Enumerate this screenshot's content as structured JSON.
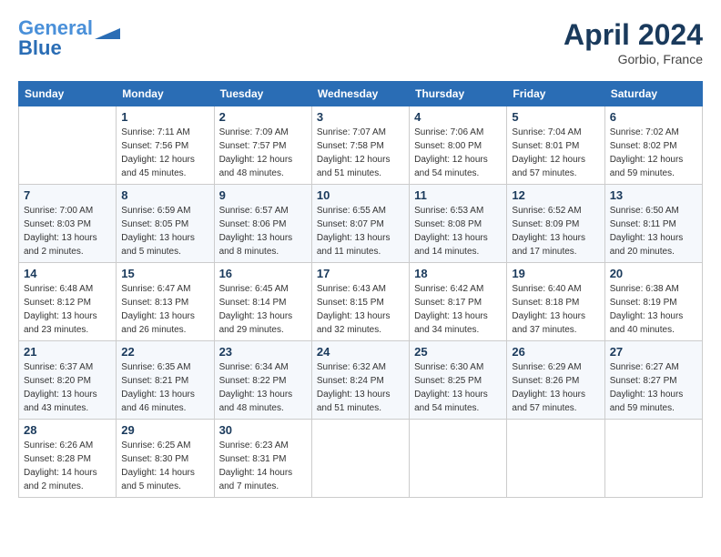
{
  "header": {
    "logo_line1": "General",
    "logo_line2": "Blue",
    "month_title": "April 2024",
    "location": "Gorbio, France"
  },
  "columns": [
    "Sunday",
    "Monday",
    "Tuesday",
    "Wednesday",
    "Thursday",
    "Friday",
    "Saturday"
  ],
  "weeks": [
    {
      "days": [
        {
          "num": "",
          "info": ""
        },
        {
          "num": "1",
          "info": "Sunrise: 7:11 AM\nSunset: 7:56 PM\nDaylight: 12 hours\nand 45 minutes."
        },
        {
          "num": "2",
          "info": "Sunrise: 7:09 AM\nSunset: 7:57 PM\nDaylight: 12 hours\nand 48 minutes."
        },
        {
          "num": "3",
          "info": "Sunrise: 7:07 AM\nSunset: 7:58 PM\nDaylight: 12 hours\nand 51 minutes."
        },
        {
          "num": "4",
          "info": "Sunrise: 7:06 AM\nSunset: 8:00 PM\nDaylight: 12 hours\nand 54 minutes."
        },
        {
          "num": "5",
          "info": "Sunrise: 7:04 AM\nSunset: 8:01 PM\nDaylight: 12 hours\nand 57 minutes."
        },
        {
          "num": "6",
          "info": "Sunrise: 7:02 AM\nSunset: 8:02 PM\nDaylight: 12 hours\nand 59 minutes."
        }
      ]
    },
    {
      "days": [
        {
          "num": "7",
          "info": "Sunrise: 7:00 AM\nSunset: 8:03 PM\nDaylight: 13 hours\nand 2 minutes."
        },
        {
          "num": "8",
          "info": "Sunrise: 6:59 AM\nSunset: 8:05 PM\nDaylight: 13 hours\nand 5 minutes."
        },
        {
          "num": "9",
          "info": "Sunrise: 6:57 AM\nSunset: 8:06 PM\nDaylight: 13 hours\nand 8 minutes."
        },
        {
          "num": "10",
          "info": "Sunrise: 6:55 AM\nSunset: 8:07 PM\nDaylight: 13 hours\nand 11 minutes."
        },
        {
          "num": "11",
          "info": "Sunrise: 6:53 AM\nSunset: 8:08 PM\nDaylight: 13 hours\nand 14 minutes."
        },
        {
          "num": "12",
          "info": "Sunrise: 6:52 AM\nSunset: 8:09 PM\nDaylight: 13 hours\nand 17 minutes."
        },
        {
          "num": "13",
          "info": "Sunrise: 6:50 AM\nSunset: 8:11 PM\nDaylight: 13 hours\nand 20 minutes."
        }
      ]
    },
    {
      "days": [
        {
          "num": "14",
          "info": "Sunrise: 6:48 AM\nSunset: 8:12 PM\nDaylight: 13 hours\nand 23 minutes."
        },
        {
          "num": "15",
          "info": "Sunrise: 6:47 AM\nSunset: 8:13 PM\nDaylight: 13 hours\nand 26 minutes."
        },
        {
          "num": "16",
          "info": "Sunrise: 6:45 AM\nSunset: 8:14 PM\nDaylight: 13 hours\nand 29 minutes."
        },
        {
          "num": "17",
          "info": "Sunrise: 6:43 AM\nSunset: 8:15 PM\nDaylight: 13 hours\nand 32 minutes."
        },
        {
          "num": "18",
          "info": "Sunrise: 6:42 AM\nSunset: 8:17 PM\nDaylight: 13 hours\nand 34 minutes."
        },
        {
          "num": "19",
          "info": "Sunrise: 6:40 AM\nSunset: 8:18 PM\nDaylight: 13 hours\nand 37 minutes."
        },
        {
          "num": "20",
          "info": "Sunrise: 6:38 AM\nSunset: 8:19 PM\nDaylight: 13 hours\nand 40 minutes."
        }
      ]
    },
    {
      "days": [
        {
          "num": "21",
          "info": "Sunrise: 6:37 AM\nSunset: 8:20 PM\nDaylight: 13 hours\nand 43 minutes."
        },
        {
          "num": "22",
          "info": "Sunrise: 6:35 AM\nSunset: 8:21 PM\nDaylight: 13 hours\nand 46 minutes."
        },
        {
          "num": "23",
          "info": "Sunrise: 6:34 AM\nSunset: 8:22 PM\nDaylight: 13 hours\nand 48 minutes."
        },
        {
          "num": "24",
          "info": "Sunrise: 6:32 AM\nSunset: 8:24 PM\nDaylight: 13 hours\nand 51 minutes."
        },
        {
          "num": "25",
          "info": "Sunrise: 6:30 AM\nSunset: 8:25 PM\nDaylight: 13 hours\nand 54 minutes."
        },
        {
          "num": "26",
          "info": "Sunrise: 6:29 AM\nSunset: 8:26 PM\nDaylight: 13 hours\nand 57 minutes."
        },
        {
          "num": "27",
          "info": "Sunrise: 6:27 AM\nSunset: 8:27 PM\nDaylight: 13 hours\nand 59 minutes."
        }
      ]
    },
    {
      "days": [
        {
          "num": "28",
          "info": "Sunrise: 6:26 AM\nSunset: 8:28 PM\nDaylight: 14 hours\nand 2 minutes."
        },
        {
          "num": "29",
          "info": "Sunrise: 6:25 AM\nSunset: 8:30 PM\nDaylight: 14 hours\nand 5 minutes."
        },
        {
          "num": "30",
          "info": "Sunrise: 6:23 AM\nSunset: 8:31 PM\nDaylight: 14 hours\nand 7 minutes."
        },
        {
          "num": "",
          "info": ""
        },
        {
          "num": "",
          "info": ""
        },
        {
          "num": "",
          "info": ""
        },
        {
          "num": "",
          "info": ""
        }
      ]
    }
  ]
}
